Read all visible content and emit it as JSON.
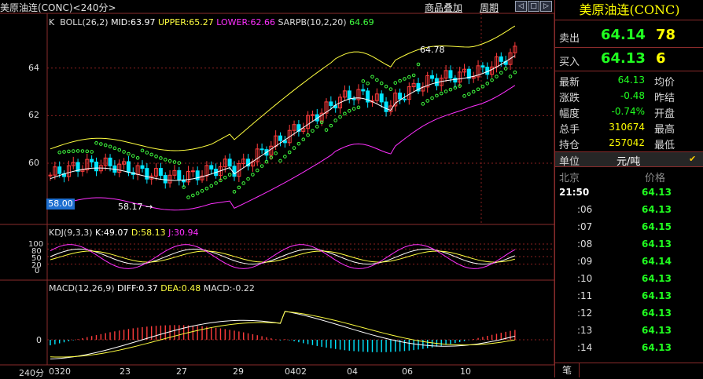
{
  "header": {
    "title": "美原油连(CONC)<240分>",
    "menu_overlay": "商品叠加",
    "menu_cycle": "周期",
    "nav_left": "◁",
    "nav_up": "□",
    "nav_right": "▷"
  },
  "main_panel": {
    "indicator_line": [
      "K",
      "BOLL(26,2)",
      "MID:63.97",
      "UPPER:65.27",
      "LOWER:62.66",
      "SARPB(10,2,20)",
      "64.69"
    ],
    "y_ticks": [
      "64",
      "62",
      "60"
    ],
    "current_price_label": "58.00",
    "annotation_high": "64.78",
    "annotation_low": "58.17 →"
  },
  "kdj_panel": {
    "indicator_line": [
      "KDJ(9,3,3)",
      "K:49.07",
      "D:58.13",
      "J:30.94"
    ],
    "y_ticks": [
      "100",
      "80",
      "50",
      "20",
      "0"
    ]
  },
  "macd_panel": {
    "indicator_line": [
      "MACD(12,26,9)",
      "DIFF:0.37",
      "DEA:0.48",
      "MACD:-0.22"
    ],
    "y_ticks": [
      "0"
    ]
  },
  "x_axis": {
    "period_label": "240分",
    "labels": [
      "0320",
      "23",
      "27",
      "29",
      "0402",
      "04",
      "06",
      "10"
    ]
  },
  "quote_panel": {
    "title": "美原油连(CONC)",
    "ask_label": "卖出",
    "ask_price": "64.14",
    "ask_volume": "78",
    "bid_label": "买入",
    "bid_price": "64.13",
    "bid_volume": "6",
    "stats": [
      {
        "label": "最新",
        "value": "64.13",
        "label2": "均价"
      },
      {
        "label": "涨跌",
        "value": "-0.48",
        "label2": "昨结"
      },
      {
        "label": "幅度",
        "value": "-0.74%",
        "label2": "开盘"
      },
      {
        "label": "总手",
        "value": "310674",
        "label2": "最高"
      },
      {
        "label": "持仓",
        "value": "257042",
        "label2": "最低"
      }
    ],
    "unit_label": "单位",
    "unit_value": "元/吨",
    "ticks_header_left": "北京",
    "ticks_header_right": "价格",
    "ticks": [
      {
        "time": "21:50",
        "price": "64.13"
      },
      {
        "time": ":06",
        "price": "64.13"
      },
      {
        "time": ":07",
        "price": "64.15"
      },
      {
        "time": ":08",
        "price": "64.13"
      },
      {
        "time": ":09",
        "price": "64.14"
      },
      {
        "time": ":10",
        "price": "64.13"
      },
      {
        "time": ":11",
        "price": "64.13"
      },
      {
        "time": ":12",
        "price": "64.13"
      },
      {
        "time": ":13",
        "price": "64.13"
      },
      {
        "time": ":14",
        "price": "64.13"
      }
    ],
    "footer_tab": "笔"
  },
  "colors": {
    "up": "#ff3c3c",
    "down": "#00e5ff",
    "upper": "#ffff40",
    "mid": "#ffffff",
    "lower": "#ff30ff",
    "sar": "#40ff40",
    "grid": "#8a2020",
    "tick_green": "#20ff20"
  }
}
